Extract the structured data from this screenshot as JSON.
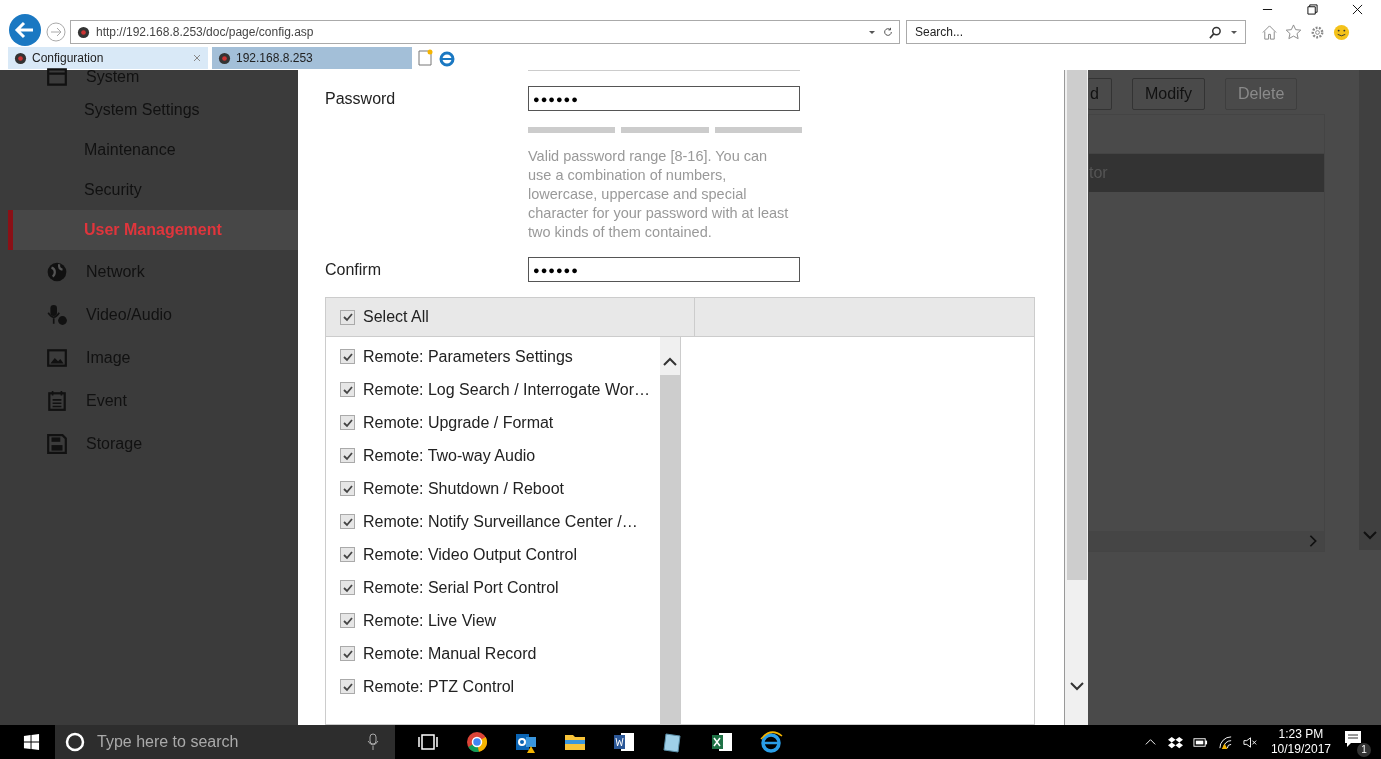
{
  "browser": {
    "address": "http://192.168.8.253/doc/page/config.asp",
    "search_placeholder": "Search...",
    "tabs": [
      {
        "label": "Configuration",
        "selected": true
      },
      {
        "label": "192.168.8.253",
        "selected": false
      }
    ]
  },
  "sidebar": {
    "items": [
      {
        "label": "System",
        "kind": "section",
        "selected": false
      },
      {
        "label": "System Settings",
        "kind": "sub",
        "selected": false
      },
      {
        "label": "Maintenance",
        "kind": "sub",
        "selected": false
      },
      {
        "label": "Security",
        "kind": "sub",
        "selected": false
      },
      {
        "label": "User Management",
        "kind": "sub",
        "selected": true
      },
      {
        "label": "Network",
        "kind": "section",
        "selected": false
      },
      {
        "label": "Video/Audio",
        "kind": "section",
        "selected": false
      },
      {
        "label": "Image",
        "kind": "section",
        "selected": false
      },
      {
        "label": "Event",
        "kind": "section",
        "selected": false
      },
      {
        "label": "Storage",
        "kind": "section",
        "selected": false
      }
    ]
  },
  "background": {
    "buttons": [
      {
        "label": "d",
        "disabled": false
      },
      {
        "label": "Modify",
        "disabled": false
      },
      {
        "label": "Delete",
        "disabled": true
      }
    ],
    "table_rows": [
      {
        "column_1": "tor",
        "selected": true
      }
    ]
  },
  "dialog": {
    "password": {
      "label": "Password",
      "value": "●●●●●●"
    },
    "hint": "Valid password range [8-16]. You can use a combination of numbers, lowercase, uppercase and special character for your password with at least two kinds of them contained.",
    "confirm": {
      "label": "Confirm",
      "value": "●●●●●●"
    },
    "select_all": {
      "label": "Select All",
      "checked": true
    },
    "permissions": [
      {
        "label": "Remote: Parameters Settings",
        "checked": true
      },
      {
        "label": "Remote: Log Search / Interrogate Wor…",
        "checked": true
      },
      {
        "label": "Remote: Upgrade / Format",
        "checked": true
      },
      {
        "label": "Remote: Two-way Audio",
        "checked": true
      },
      {
        "label": "Remote: Shutdown / Reboot",
        "checked": true
      },
      {
        "label": "Remote: Notify Surveillance Center /…",
        "checked": true
      },
      {
        "label": "Remote: Video Output Control",
        "checked": true
      },
      {
        "label": "Remote: Serial Port Control",
        "checked": true
      },
      {
        "label": "Remote: Live View",
        "checked": true
      },
      {
        "label": "Remote: Manual Record",
        "checked": true
      },
      {
        "label": "Remote: PTZ Control",
        "checked": true
      }
    ]
  },
  "taskbar": {
    "search_placeholder": "Type here to search",
    "time": "1:23 PM",
    "date": "10/19/2017",
    "notification_count": "1"
  }
}
